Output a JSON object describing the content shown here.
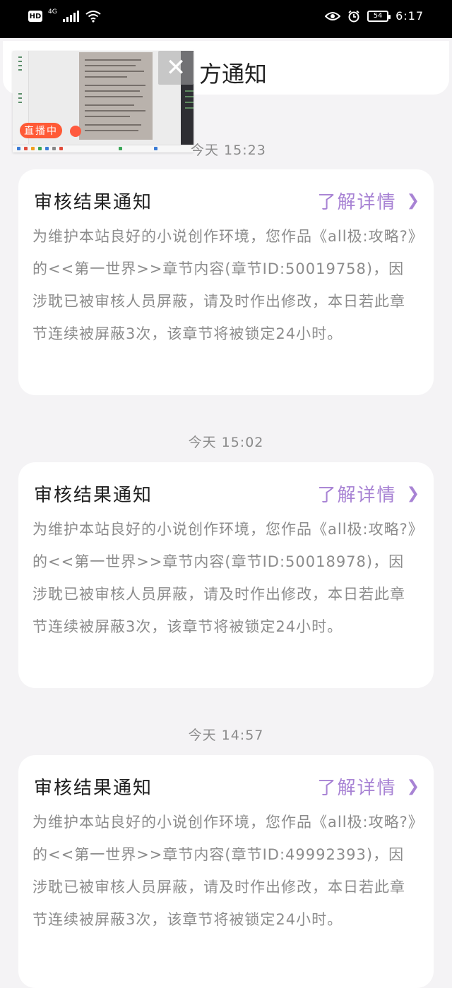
{
  "status_bar": {
    "hd": "HD",
    "network": "4G",
    "battery": "54",
    "time": "6:17"
  },
  "header": {
    "title": "方通知"
  },
  "live_window": {
    "badge": "直播中",
    "close_symbol": "✕"
  },
  "notifications": [
    {
      "timestamp": "今天 15:23",
      "title": "审核结果通知",
      "link": "了解详情",
      "body": "为维护本站良好的小说创作环境，您作品《all极:攻略?》的<<第一世界>>章节内容(章节ID:50019758)，因涉耽已被审核人员屏蔽，请及时作出修改，本日若此章节连续被屏蔽3次，该章节将被锁定24小时。"
    },
    {
      "timestamp": "今天 15:02",
      "title": "审核结果通知",
      "link": "了解详情",
      "body": "为维护本站良好的小说创作环境，您作品《all极:攻略?》的<<第一世界>>章节内容(章节ID:50018978)，因涉耽已被审核人员屏蔽，请及时作出修改，本日若此章节连续被屏蔽3次，该章节将被锁定24小时。"
    },
    {
      "timestamp": "今天 14:57",
      "title": "审核结果通知",
      "link": "了解详情",
      "body": "为维护本站良好的小说创作环境，您作品《all极:攻略?》的<<第一世界>>章节内容(章节ID:49992393)，因涉耽已被审核人员屏蔽，请及时作出修改，本日若此章节连续被屏蔽3次，该章节将被锁定24小时。"
    }
  ],
  "colors": {
    "accent": "#a883d4",
    "live_red": "#ff5a36",
    "background": "#f4f3f5"
  }
}
